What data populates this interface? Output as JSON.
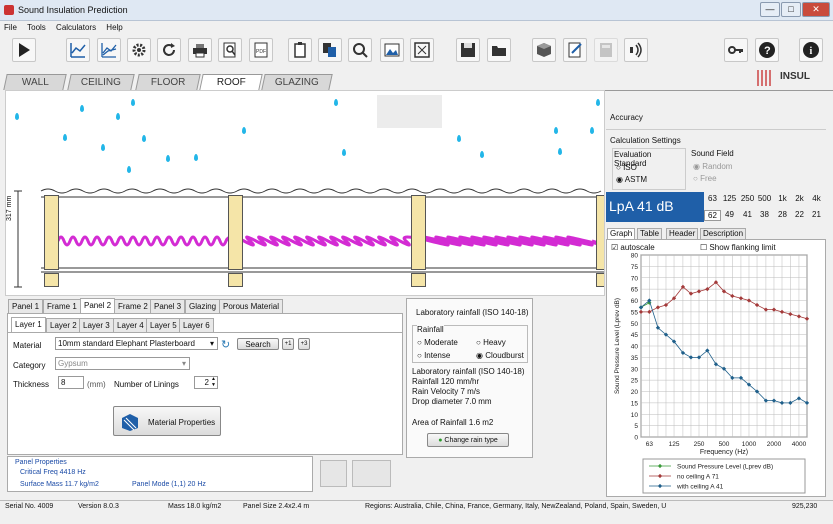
{
  "window": {
    "title": "Sound Insulation Prediction",
    "min": "—",
    "max": "□",
    "close": "✕"
  },
  "menu": [
    "File",
    "Tools",
    "Calculators",
    "Help"
  ],
  "toolbar_icons": [
    "play-icon",
    "graph-icon",
    "graph-compare-icon",
    "settings-icon",
    "refresh-icon",
    "print-icon",
    "print-preview-icon",
    "pdf-icon",
    "clipboard-icon",
    "copy-icon",
    "search-globe-icon",
    "image-icon",
    "fullscreen-icon",
    "save-icon",
    "open-folder-icon",
    "cube-icon",
    "edit-icon",
    "calculator-icon",
    "sound-icon",
    "key-icon",
    "help-icon",
    "info-icon"
  ],
  "tabs": [
    "WALL",
    "CEILING",
    "FLOOR",
    "ROOF",
    "GLAZING"
  ],
  "active_tab": "ROOF",
  "logo": "INSUL",
  "drawing": {
    "dimension": "317 mm"
  },
  "panel_tabs": [
    "Panel 1",
    "Frame 1",
    "Panel 2",
    "Frame 2",
    "Panel 3",
    "Glazing",
    "Porous Material"
  ],
  "active_panel_tab": "Panel 2",
  "layer_tabs": [
    "Layer 1",
    "Layer 2",
    "Layer 3",
    "Layer 4",
    "Layer 5",
    "Layer 6"
  ],
  "active_layer_tab": "Layer 1",
  "material": {
    "label": "Material",
    "value": "10mm standard Elephant Plasterboard",
    "search": "Search",
    "plus1": "+1",
    "plus3": "+3"
  },
  "category": {
    "label": "Category",
    "value": "Gypsum"
  },
  "thickness": {
    "label": "Thickness",
    "value": "8",
    "unit": "(mm)"
  },
  "linings": {
    "label": "Number of Linings",
    "value": "2"
  },
  "material_properties": "Material Properties",
  "panel_properties": {
    "title": "Panel Properties",
    "critical": "Critical Freq 4418 Hz",
    "surface": "Surface Mass 11.7 kg/m2",
    "mode": "Panel Mode (1,1) 20 Hz"
  },
  "rain": {
    "title": "Laboratory rainfall (ISO 140-18)",
    "group": "Rainfall",
    "options": [
      "Moderate",
      "Heavy",
      "Intense",
      "Cloudburst"
    ],
    "selected": "Cloudburst",
    "info": [
      "Laboratory rainfall (ISO 140-18)",
      "Rainfall 120 mm/hr",
      "Rain Velocity 7 m/s",
      "Drop diameter 7.0  mm"
    ],
    "area": "Area of Rainfall 1.6 m2",
    "button": "Change rain type"
  },
  "accuracy": "Accuracy",
  "calc_settings": "Calculation Settings",
  "eval_standard": {
    "label": "Evaluation Standard",
    "options": [
      "ISO",
      "ASTM"
    ],
    "selected": "ASTM"
  },
  "sound_field": {
    "label": "Sound Field",
    "options": [
      "Random",
      "Free"
    ]
  },
  "lpa": "LpA 41 dB",
  "octaves": {
    "freqs": [
      "63",
      "125",
      "250",
      "500",
      "1k",
      "2k",
      "4k"
    ],
    "values": [
      "62",
      "49",
      "41",
      "38",
      "28",
      "22",
      "21"
    ]
  },
  "right_tabs": [
    "Graph",
    "Table",
    "Header",
    "Description"
  ],
  "autoscale": "autoscale",
  "flanking": "Show flanking limit",
  "status": {
    "serial": "Serial No. 4009",
    "version": "Version  8.0.3",
    "mass": "Mass 18.0 kg/m2",
    "size": "Panel Size 2.4x2.4 m",
    "regions": "Regions: Australia, Chile, China, France, Germany, Italy, NewZealand, Poland, Spain, Sweden, U",
    "coords": "925,230"
  },
  "chart_data": {
    "type": "line",
    "ylabel": "Sound Pressure Level (Lprev dB)",
    "xlabel": "Frequency (Hz)",
    "ylim": [
      0,
      80
    ],
    "yticks": [
      0,
      5,
      10,
      15,
      20,
      25,
      30,
      35,
      40,
      45,
      50,
      55,
      60,
      65,
      70,
      75,
      80
    ],
    "xticks": [
      "63",
      "125",
      "250",
      "500",
      "1000",
      "2000",
      "4000"
    ],
    "x": [
      50,
      63,
      80,
      100,
      125,
      160,
      200,
      250,
      315,
      400,
      500,
      630,
      800,
      1000,
      1250,
      1600,
      2000,
      2500,
      3150,
      4000,
      5000
    ],
    "series": [
      {
        "name": "Sound Pressure Level (Lprev dB)",
        "color": "#3a9a3a",
        "values": [
          57,
          59,
          null,
          null,
          null,
          null,
          null,
          null,
          null,
          null,
          null,
          null,
          null,
          null,
          null,
          null,
          null,
          null,
          null,
          null,
          null
        ]
      },
      {
        "name": "no ceiling A 71",
        "color": "#a33a3a",
        "values": [
          55,
          55,
          57,
          58,
          61,
          66,
          63,
          64,
          65,
          68,
          64,
          62,
          61,
          60,
          58,
          56,
          56,
          55,
          54,
          53,
          52
        ]
      },
      {
        "name": "with ceiling A 41",
        "color": "#1f5f8a",
        "values": [
          57,
          60,
          48,
          45,
          42,
          37,
          35,
          35,
          38,
          32,
          30,
          26,
          26,
          23,
          20,
          16,
          16,
          15,
          15,
          17,
          15
        ]
      }
    ],
    "legend": "bottom",
    "grid": true
  }
}
